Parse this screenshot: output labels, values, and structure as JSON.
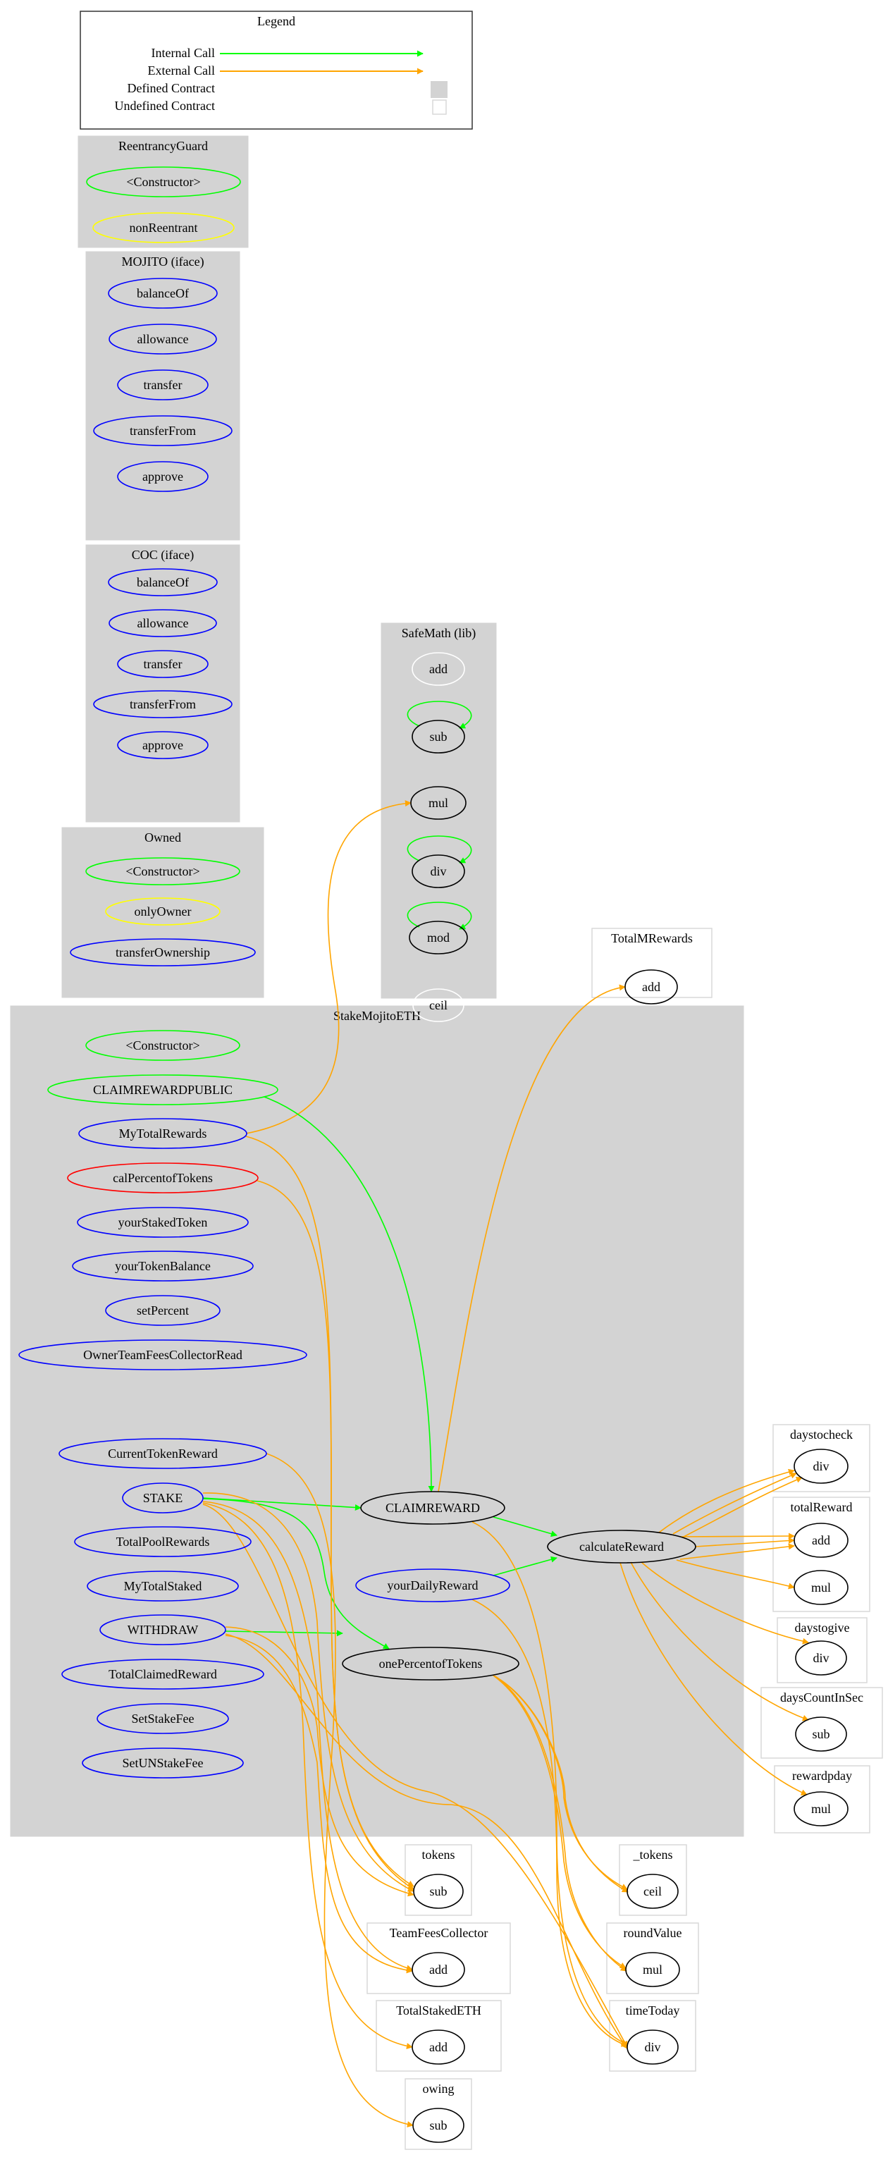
{
  "legend": {
    "title": "Legend",
    "items": [
      {
        "label": "Internal Call",
        "kind": "arrow",
        "color": "#00ff00"
      },
      {
        "label": "External Call",
        "kind": "arrow",
        "color": "#ffa500"
      },
      {
        "label": "Defined Contract",
        "kind": "swatch",
        "color": "#d3d3d3"
      },
      {
        "label": "Undefined Contract",
        "kind": "swatch",
        "color": "#ffffff"
      }
    ]
  },
  "colors": {
    "internal": "#00ff00",
    "external": "#ffa500",
    "defined": "#d3d3d3",
    "public": "#0000ff",
    "constructor": "#00ff00",
    "modifier": "#ffff00",
    "internalFn": "#ff0000",
    "unused": "#ffffff",
    "plain": "#000000"
  },
  "clusters": [
    {
      "id": "ReentrancyGuard",
      "label": "ReentrancyGuard",
      "defined": true,
      "nodes": [
        {
          "id": "RG_ctor",
          "label": "<Constructor>",
          "color": "#00ff00"
        },
        {
          "id": "RG_nonReentrant",
          "label": "nonReentrant",
          "color": "#ffff00"
        }
      ]
    },
    {
      "id": "MOJITO",
      "label": "MOJITO  (iface)",
      "defined": true,
      "nodes": [
        {
          "id": "MJ_balanceOf",
          "label": "balanceOf",
          "color": "#0000ff"
        },
        {
          "id": "MJ_allowance",
          "label": "allowance",
          "color": "#0000ff"
        },
        {
          "id": "MJ_transfer",
          "label": "transfer",
          "color": "#0000ff"
        },
        {
          "id": "MJ_transferFrom",
          "label": "transferFrom",
          "color": "#0000ff"
        },
        {
          "id": "MJ_approve",
          "label": "approve",
          "color": "#0000ff"
        }
      ]
    },
    {
      "id": "COC",
      "label": "COC  (iface)",
      "defined": true,
      "nodes": [
        {
          "id": "COC_balanceOf",
          "label": "balanceOf",
          "color": "#0000ff"
        },
        {
          "id": "COC_allowance",
          "label": "allowance",
          "color": "#0000ff"
        },
        {
          "id": "COC_transfer",
          "label": "transfer",
          "color": "#0000ff"
        },
        {
          "id": "COC_transferFrom",
          "label": "transferFrom",
          "color": "#0000ff"
        },
        {
          "id": "COC_approve",
          "label": "approve",
          "color": "#0000ff"
        }
      ]
    },
    {
      "id": "SafeMath",
      "label": "SafeMath  (lib)",
      "defined": true,
      "nodes": [
        {
          "id": "SM_add",
          "label": "add",
          "color": "#ffffff"
        },
        {
          "id": "SM_sub",
          "label": "sub",
          "color": "#000000"
        },
        {
          "id": "SM_mul",
          "label": "mul",
          "color": "#000000"
        },
        {
          "id": "SM_div",
          "label": "div",
          "color": "#000000"
        },
        {
          "id": "SM_mod",
          "label": "mod",
          "color": "#000000"
        },
        {
          "id": "SM_ceil",
          "label": "ceil",
          "color": "#ffffff"
        }
      ]
    },
    {
      "id": "Owned",
      "label": "Owned",
      "defined": true,
      "nodes": [
        {
          "id": "OW_ctor",
          "label": "<Constructor>",
          "color": "#00ff00"
        },
        {
          "id": "OW_onlyOwner",
          "label": "onlyOwner",
          "color": "#ffff00"
        },
        {
          "id": "OW_transferOwnership",
          "label": "transferOwnership",
          "color": "#0000ff"
        }
      ]
    },
    {
      "id": "TotalMRewards",
      "label": "TotalMRewards",
      "defined": false,
      "nodes": [
        {
          "id": "TMR_add",
          "label": "add",
          "color": "#000000"
        }
      ]
    },
    {
      "id": "StakeMojitoETH",
      "label": "StakeMojitoETH",
      "defined": true,
      "nodes": [
        {
          "id": "S_ctor",
          "label": "<Constructor>",
          "color": "#00ff00"
        },
        {
          "id": "S_CLAIMREWARDPUBLIC",
          "label": "CLAIMREWARDPUBLIC",
          "color": "#00ff00"
        },
        {
          "id": "S_MyTotalRewards",
          "label": "MyTotalRewards",
          "color": "#0000ff"
        },
        {
          "id": "S_calPercentofTokens",
          "label": "calPercentofTokens",
          "color": "#ff0000"
        },
        {
          "id": "S_yourStakedToken",
          "label": "yourStakedToken",
          "color": "#0000ff"
        },
        {
          "id": "S_yourTokenBalance",
          "label": "yourTokenBalance",
          "color": "#0000ff"
        },
        {
          "id": "S_setPercent",
          "label": "setPercent",
          "color": "#0000ff"
        },
        {
          "id": "S_OwnerTeamFeesCollectorRead",
          "label": "OwnerTeamFeesCollectorRead",
          "color": "#0000ff"
        },
        {
          "id": "S_CurrentTokenReward",
          "label": "CurrentTokenReward",
          "color": "#0000ff"
        },
        {
          "id": "S_STAKE",
          "label": "STAKE",
          "color": "#0000ff"
        },
        {
          "id": "S_TotalPoolRewards",
          "label": "TotalPoolRewards",
          "color": "#0000ff"
        },
        {
          "id": "S_MyTotalStaked",
          "label": "MyTotalStaked",
          "color": "#0000ff"
        },
        {
          "id": "S_WITHDRAW",
          "label": "WITHDRAW",
          "color": "#0000ff"
        },
        {
          "id": "S_TotalClaimedReward",
          "label": "TotalClaimedReward",
          "color": "#0000ff"
        },
        {
          "id": "S_SetStakeFee",
          "label": "SetStakeFee",
          "color": "#0000ff"
        },
        {
          "id": "S_SetUNStakeFee",
          "label": "SetUNStakeFee",
          "color": "#0000ff"
        },
        {
          "id": "S_CLAIMREWARD",
          "label": "CLAIMREWARD",
          "color": "#000000"
        },
        {
          "id": "S_yourDailyReward",
          "label": "yourDailyReward",
          "color": "#0000ff"
        },
        {
          "id": "S_onePercentofTokens",
          "label": "onePercentofTokens",
          "color": "#000000"
        },
        {
          "id": "S_calculateReward",
          "label": "calculateReward",
          "color": "#000000"
        }
      ]
    },
    {
      "id": "daystocheck",
      "label": "daystocheck",
      "defined": false,
      "nodes": [
        {
          "id": "DTC_div",
          "label": "div",
          "color": "#000000"
        }
      ]
    },
    {
      "id": "totalReward",
      "label": "totalReward",
      "defined": false,
      "nodes": [
        {
          "id": "TR_add",
          "label": "add",
          "color": "#000000"
        },
        {
          "id": "TR_mul",
          "label": "mul",
          "color": "#000000"
        }
      ]
    },
    {
      "id": "daystogive",
      "label": "daystogive",
      "defined": false,
      "nodes": [
        {
          "id": "DTG_div",
          "label": "div",
          "color": "#000000"
        }
      ]
    },
    {
      "id": "daysCountInSec",
      "label": "daysCountInSec",
      "defined": false,
      "nodes": [
        {
          "id": "DCS_sub",
          "label": "sub",
          "color": "#000000"
        }
      ]
    },
    {
      "id": "rewardpday",
      "label": "rewardpday",
      "defined": false,
      "nodes": [
        {
          "id": "RPD_mul",
          "label": "mul",
          "color": "#000000"
        }
      ]
    },
    {
      "id": "tokens",
      "label": "tokens",
      "defined": false,
      "nodes": [
        {
          "id": "TK_sub",
          "label": "sub",
          "color": "#000000"
        }
      ]
    },
    {
      "id": "_tokens",
      "label": "_tokens",
      "defined": false,
      "nodes": [
        {
          "id": "_TK_ceil",
          "label": "ceil",
          "color": "#000000"
        }
      ]
    },
    {
      "id": "TeamFeesCollector",
      "label": "TeamFeesCollector",
      "defined": false,
      "nodes": [
        {
          "id": "TFC_add",
          "label": "add",
          "color": "#000000"
        }
      ]
    },
    {
      "id": "roundValue",
      "label": "roundValue",
      "defined": false,
      "nodes": [
        {
          "id": "RV_mul",
          "label": "mul",
          "color": "#000000"
        }
      ]
    },
    {
      "id": "TotalStakedETH",
      "label": "TotalStakedETH",
      "defined": false,
      "nodes": [
        {
          "id": "TSE_add",
          "label": "add",
          "color": "#000000"
        }
      ]
    },
    {
      "id": "timeToday",
      "label": "timeToday",
      "defined": false,
      "nodes": [
        {
          "id": "TT_div",
          "label": "div",
          "color": "#000000"
        }
      ]
    },
    {
      "id": "owing",
      "label": "owing",
      "defined": false,
      "nodes": [
        {
          "id": "OWG_sub",
          "label": "sub",
          "color": "#000000"
        }
      ]
    }
  ],
  "edges": [
    {
      "from": "SM_sub",
      "to": "SM_sub",
      "type": "internal"
    },
    {
      "from": "SM_div",
      "to": "SM_div",
      "type": "internal"
    },
    {
      "from": "SM_mod",
      "to": "SM_mod",
      "type": "internal"
    },
    {
      "from": "S_MyTotalRewards",
      "to": "SM_mul",
      "type": "external"
    },
    {
      "from": "S_CLAIMREWARD",
      "to": "TMR_add",
      "type": "external"
    },
    {
      "from": "S_CLAIMREWARDPUBLIC",
      "to": "S_CLAIMREWARD",
      "type": "internal"
    },
    {
      "from": "S_STAKE",
      "to": "S_CLAIMREWARD",
      "type": "internal"
    },
    {
      "from": "S_STAKE",
      "to": "S_onePercentofTokens",
      "type": "internal"
    },
    {
      "from": "S_WITHDRAW",
      "to": "S_onePercentofTokens",
      "type": "internal"
    },
    {
      "from": "S_CLAIMREWARD",
      "to": "S_calculateReward",
      "type": "internal"
    },
    {
      "from": "S_yourDailyReward",
      "to": "S_calculateReward",
      "type": "internal"
    },
    {
      "from": "S_calculateReward",
      "to": "DTC_div",
      "type": "external"
    },
    {
      "from": "S_calculateReward",
      "to": "DTC_div",
      "type": "external"
    },
    {
      "from": "S_calculateReward",
      "to": "DTC_div",
      "type": "external"
    },
    {
      "from": "S_calculateReward",
      "to": "TR_add",
      "type": "external"
    },
    {
      "from": "S_calculateReward",
      "to": "TR_add",
      "type": "external"
    },
    {
      "from": "S_calculateReward",
      "to": "TR_add",
      "type": "external"
    },
    {
      "from": "S_calculateReward",
      "to": "TR_mul",
      "type": "external"
    },
    {
      "from": "S_calculateReward",
      "to": "DTG_div",
      "type": "external"
    },
    {
      "from": "S_calculateReward",
      "to": "DCS_sub",
      "type": "external"
    },
    {
      "from": "S_calculateReward",
      "to": "RPD_mul",
      "type": "external"
    },
    {
      "from": "S_MyTotalRewards",
      "to": "TK_sub",
      "type": "external"
    },
    {
      "from": "S_calPercentofTokens",
      "to": "TK_sub",
      "type": "external"
    },
    {
      "from": "S_STAKE",
      "to": "TK_sub",
      "type": "external"
    },
    {
      "from": "S_WITHDRAW",
      "to": "TK_sub",
      "type": "external"
    },
    {
      "from": "S_STAKE",
      "to": "TFC_add",
      "type": "external"
    },
    {
      "from": "S_WITHDRAW",
      "to": "TFC_add",
      "type": "external"
    },
    {
      "from": "S_STAKE",
      "to": "TSE_add",
      "type": "external"
    },
    {
      "from": "S_CurrentTokenReward",
      "to": "OWG_sub",
      "type": "external"
    },
    {
      "from": "S_onePercentofTokens",
      "to": "_TK_ceil",
      "type": "external"
    },
    {
      "from": "S_onePercentofTokens",
      "to": "_TK_ceil",
      "type": "external"
    },
    {
      "from": "S_onePercentofTokens",
      "to": "RV_mul",
      "type": "external"
    },
    {
      "from": "S_onePercentofTokens",
      "to": "RV_mul",
      "type": "external"
    },
    {
      "from": "S_CLAIMREWARD",
      "to": "TT_div",
      "type": "external"
    },
    {
      "from": "S_yourDailyReward",
      "to": "TT_div",
      "type": "external"
    },
    {
      "from": "S_STAKE",
      "to": "TT_div",
      "type": "external"
    },
    {
      "from": "S_WITHDRAW",
      "to": "TT_div",
      "type": "external"
    }
  ]
}
